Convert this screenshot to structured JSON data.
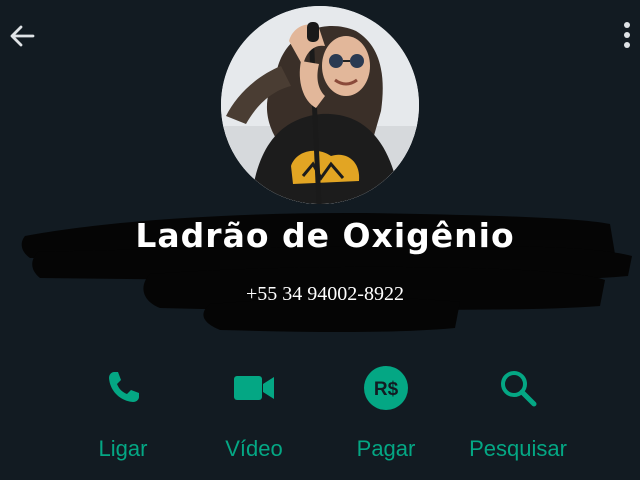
{
  "header": {
    "back_icon": "arrow-left-icon",
    "menu_icon": "more-vertical-icon"
  },
  "contact": {
    "name": "Ladrão de Oxigênio",
    "phone": "+55 34 94002-8922"
  },
  "actions": [
    {
      "label": "Ligar",
      "icon": "phone-icon"
    },
    {
      "label": "Vídeo",
      "icon": "video-camera-icon"
    },
    {
      "label": "Pagar",
      "icon": "real-currency-icon"
    },
    {
      "label": "Pesquisar",
      "icon": "search-icon"
    }
  ],
  "colors": {
    "background": "#121b22",
    "accent": "#04a784",
    "text": "#ffffff",
    "icons": "#dfe3e6"
  }
}
